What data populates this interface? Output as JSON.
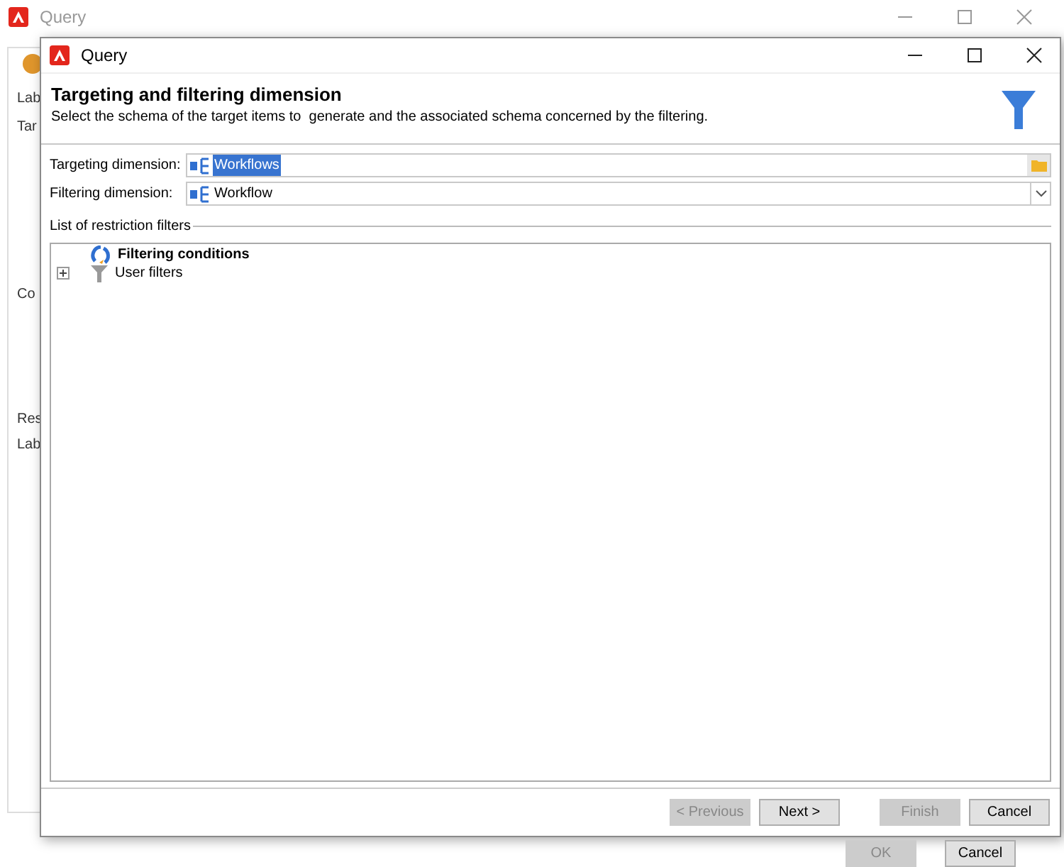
{
  "background_window": {
    "title": "Query",
    "labels": [
      "Lab",
      "Tar",
      "Co",
      "Res",
      "Lab"
    ],
    "buttons": [
      {
        "label": "OK",
        "disabled": true
      },
      {
        "label": "Cancel",
        "disabled": false
      }
    ]
  },
  "dialog": {
    "title": "Query",
    "heading": "Targeting and filtering dimension",
    "description": "Select the schema of the target items to  generate and the associated schema concerned by the filtering.",
    "fields": [
      {
        "kind": "browse",
        "label": "Targeting dimension:",
        "value": "Workflows",
        "selected": true
      },
      {
        "kind": "dropdown",
        "label": "Filtering dimension:",
        "value": "Workflow",
        "selected": false
      }
    ],
    "filters_label": "List of restriction filters",
    "tree": [
      {
        "kind": "conditions",
        "label": "Filtering conditions"
      },
      {
        "kind": "user",
        "label": "User filters",
        "expanded": false
      }
    ],
    "buttons": [
      {
        "label": "< Previous",
        "disabled": true
      },
      {
        "label": "Next >",
        "disabled": false
      },
      {
        "label": "Finish",
        "disabled": true
      },
      {
        "label": "Cancel",
        "disabled": false
      }
    ]
  }
}
